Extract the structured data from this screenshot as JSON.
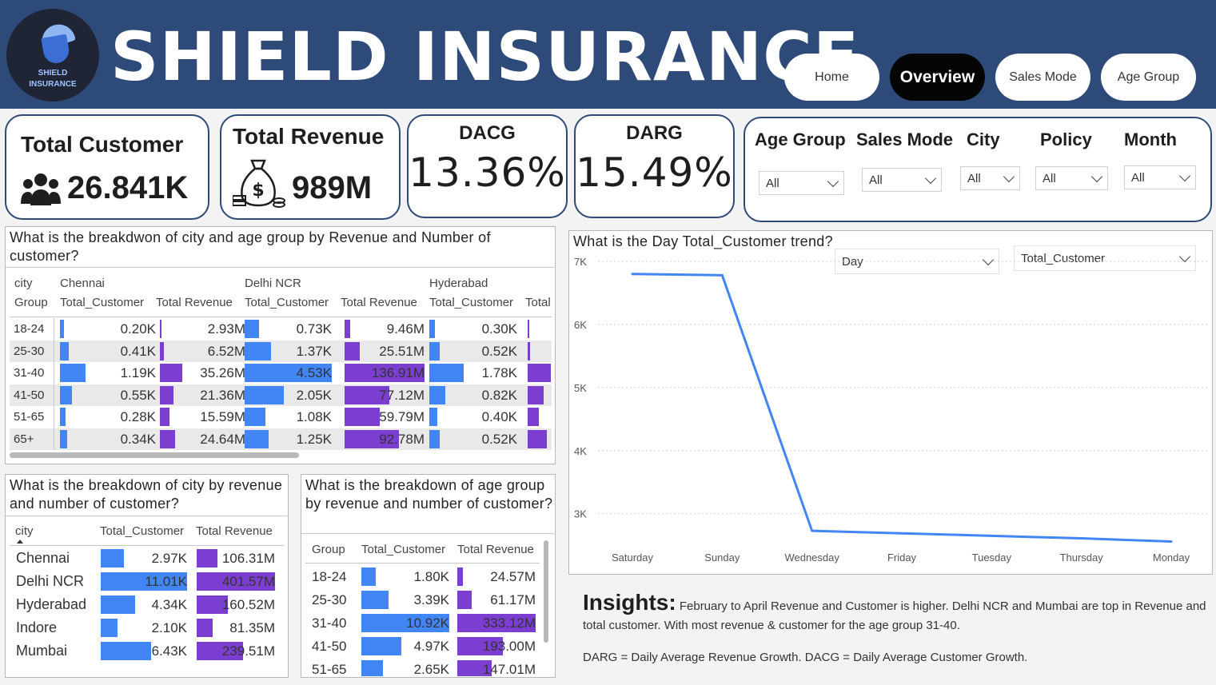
{
  "brand": {
    "title": "SHIELD INSURANCE",
    "logo_line1": "SHIELD",
    "logo_line2": "INSURANCE"
  },
  "nav": [
    {
      "label": "Home",
      "active": false
    },
    {
      "label": "Overview",
      "active": true
    },
    {
      "label": "Sales Mode",
      "active": false
    },
    {
      "label": "Age Group",
      "active": false
    }
  ],
  "kpis": {
    "total_customer": {
      "title": "Total Customer",
      "value": "26.841K",
      "icon": "people-icon"
    },
    "total_revenue": {
      "title": "Total Revenue",
      "value": "989M",
      "icon": "money-bag-icon"
    },
    "dacg": {
      "title": "DACG",
      "value": "13.36%"
    },
    "darg": {
      "title": "DARG",
      "value": "15.49%"
    }
  },
  "slicers": [
    {
      "title": "Age Group",
      "value": "All"
    },
    {
      "title": "Sales Mode",
      "value": "All"
    },
    {
      "title": "City",
      "value": "All"
    },
    {
      "title": "Policy",
      "value": "All"
    },
    {
      "title": "Month",
      "value": "All"
    }
  ],
  "matrix": {
    "title": "What is the breakdwon of city and age group by Revenue and Number of customer?",
    "corner_top": "city",
    "corner_bottom": "Group",
    "cities": [
      "Chennai",
      "Delhi NCR",
      "Hyderabad"
    ],
    "measure_customer": "Total_Customer",
    "measure_revenue": "Total Revenue",
    "measure_truncated": "Total",
    "rows": [
      {
        "group": "18-24",
        "chennai_c": "0.20K",
        "chennai_r": "2.93M",
        "delhi_c": "0.73K",
        "delhi_r": "9.46M",
        "hyd_c": "0.30K"
      },
      {
        "group": "25-30",
        "chennai_c": "0.41K",
        "chennai_r": "6.52M",
        "delhi_c": "1.37K",
        "delhi_r": "25.51M",
        "hyd_c": "0.52K"
      },
      {
        "group": "31-40",
        "chennai_c": "1.19K",
        "chennai_r": "35.26M",
        "delhi_c": "4.53K",
        "delhi_r": "136.91M",
        "hyd_c": "1.78K"
      },
      {
        "group": "41-50",
        "chennai_c": "0.55K",
        "chennai_r": "21.36M",
        "delhi_c": "2.05K",
        "delhi_r": "77.12M",
        "hyd_c": "0.82K"
      },
      {
        "group": "51-65",
        "chennai_c": "0.28K",
        "chennai_r": "15.59M",
        "delhi_c": "1.08K",
        "delhi_r": "59.79M",
        "hyd_c": "0.40K"
      },
      {
        "group": "65+",
        "chennai_c": "0.34K",
        "chennai_r": "24.64M",
        "delhi_c": "1.25K",
        "delhi_r": "92.78M",
        "hyd_c": "0.52K"
      }
    ],
    "bars": {
      "chennai_c": [
        0.2,
        0.41,
        1.19,
        0.55,
        0.28,
        0.34
      ],
      "chennai_r": [
        2.93,
        6.52,
        35.26,
        21.36,
        15.59,
        24.64
      ],
      "delhi_c": [
        0.73,
        1.37,
        4.53,
        2.05,
        1.08,
        1.25
      ],
      "delhi_r": [
        9.46,
        25.51,
        136.91,
        77.12,
        59.79,
        92.78
      ],
      "hyd_c": [
        0.3,
        0.52,
        1.78,
        0.82,
        0.4,
        0.52
      ],
      "hyd_r_fraction": [
        0.05,
        0.1,
        0.95,
        0.65,
        0.45,
        0.8
      ]
    }
  },
  "city_table": {
    "title": "What is the breakdown of city by revenue and number of customer?",
    "col_city": "city",
    "col_customer": "Total_Customer",
    "col_revenue": "Total Revenue",
    "rows": [
      {
        "city": "Chennai",
        "customer": "2.97K",
        "revenue": "106.31M",
        "c": 2.97,
        "r": 106.31
      },
      {
        "city": "Delhi NCR",
        "customer": "11.01K",
        "revenue": "401.57M",
        "c": 11.01,
        "r": 401.57
      },
      {
        "city": "Hyderabad",
        "customer": "4.34K",
        "revenue": "160.52M",
        "c": 4.34,
        "r": 160.52
      },
      {
        "city": "Indore",
        "customer": "2.10K",
        "revenue": "81.35M",
        "c": 2.1,
        "r": 81.35
      },
      {
        "city": "Mumbai",
        "customer": "6.43K",
        "revenue": "239.51M",
        "c": 6.43,
        "r": 239.51
      }
    ]
  },
  "age_table": {
    "title": "What is the breakdown of age group by revenue and number of customer?",
    "col_group": "Group",
    "col_customer": "Total_Customer",
    "col_revenue": "Total Revenue",
    "rows": [
      {
        "group": "18-24",
        "customer": "1.80K",
        "revenue": "24.57M",
        "c": 1.8,
        "r": 24.57
      },
      {
        "group": "25-30",
        "customer": "3.39K",
        "revenue": "61.17M",
        "c": 3.39,
        "r": 61.17
      },
      {
        "group": "31-40",
        "customer": "10.92K",
        "revenue": "333.12M",
        "c": 10.92,
        "r": 333.12
      },
      {
        "group": "41-50",
        "customer": "4.97K",
        "revenue": "193.00M",
        "c": 4.97,
        "r": 193.0
      },
      {
        "group": "51-65",
        "customer": "2.65K",
        "revenue": "147.01M",
        "c": 2.65,
        "r": 147.01
      }
    ]
  },
  "line_chart": {
    "title": "What is the Day Total_Customer trend?",
    "dropdown_day": "Day",
    "dropdown_measure": "Total_Customer",
    "line_color": "#4285f4"
  },
  "chart_data": {
    "type": "line",
    "title": "What is the Day Total_Customer trend?",
    "categories": [
      "Saturday",
      "Sunday",
      "Wednesday",
      "Friday",
      "Tuesday",
      "Thursday",
      "Monday"
    ],
    "series": [
      {
        "name": "Total_Customer",
        "values": [
          6800,
          6780,
          2730,
          2690,
          2650,
          2610,
          2560
        ]
      }
    ],
    "y_ticks": [
      "7K",
      "6K",
      "5K",
      "4K",
      "3K"
    ],
    "ylim": [
      2300,
      7000
    ],
    "grid": true
  },
  "insights": {
    "title": "Insights:",
    "text": "February to April Revenue and Customer is higher. Delhi NCR and Mumbai are top in Revenue and total customer. With most revenue & customer for the age group 31-40.",
    "definitions": "DARG = Daily Average Revenue Growth.  DACG = Daily Average Customer Growth."
  },
  "colors": {
    "header": "#2d4a78",
    "customer_bar": "#4285f4",
    "revenue_bar": "#7b3ed0"
  }
}
